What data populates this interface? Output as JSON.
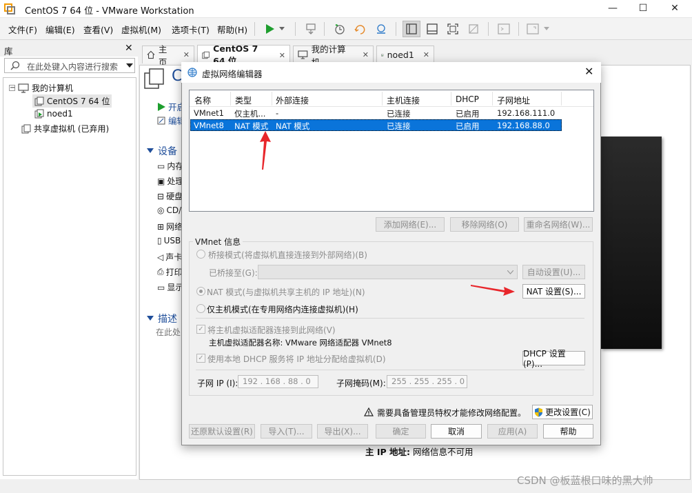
{
  "window": {
    "title": "CentOS 7 64 位 - VMware Workstation",
    "min": "—",
    "max": "☐",
    "close": "✕"
  },
  "menu": {
    "items": [
      "文件(F)",
      "编辑(E)",
      "查看(V)",
      "虚拟机(M)",
      "选项卡(T)",
      "帮助(H)"
    ]
  },
  "library": {
    "title": "库",
    "close": "✕",
    "search_placeholder": "在此处键入内容进行搜索",
    "tree": {
      "root": "我的计算机",
      "children": [
        "CentOS 7 64 位",
        "noed1"
      ],
      "shared": "共享虚拟机 (已弃用)"
    }
  },
  "tabs": [
    {
      "label": "主页",
      "close": "✕"
    },
    {
      "label": "CentOS 7 64 位",
      "close": "✕"
    },
    {
      "label": "我的计算机",
      "close": "✕"
    },
    {
      "label": "noed1",
      "close": "✕"
    }
  ],
  "main": {
    "vm_title_letter": "C",
    "power_on": "开启",
    "edit": "编辑",
    "devices_header": "设备",
    "devices": [
      "内存",
      "处理",
      "硬盘",
      "CD/",
      "网络",
      "USB",
      "声卡",
      "打印",
      "显示"
    ],
    "desc_header": "描述",
    "desc_hint": "在此处",
    "ip_label": "主 IP 地址:",
    "ip_value": "网络信息不可用"
  },
  "dialog": {
    "title": "虚拟网络编辑器",
    "close": "✕",
    "columns": [
      "名称",
      "类型",
      "外部连接",
      "主机连接",
      "DHCP",
      "子网地址"
    ],
    "rows": [
      [
        "VMnet1",
        "仅主机...",
        "-",
        "已连接",
        "已启用",
        "192.168.111.0"
      ],
      [
        "VMnet8",
        "NAT 模式",
        "NAT 模式",
        "已连接",
        "已启用",
        "192.168.88.0"
      ]
    ],
    "selected_row": 1,
    "add_network": "添加网络(E)...",
    "remove_network": "移除网络(O)",
    "rename_network": "重命名网络(W)...",
    "vmnet_info": "VMnet 信息",
    "bridge_mode": "桥接模式(将虚拟机直接连接到外部网络)(B)",
    "bridged_to": "已桥接至(G):",
    "auto_settings": "自动设置(U)...",
    "nat_mode": "NAT 模式(与虚拟机共享主机的 IP 地址)(N)",
    "nat_settings": "NAT 设置(S)...",
    "host_only_mode": "仅主机模式(在专用网络内连接虚拟机)(H)",
    "connect_adapter": "将主机虚拟适配器连接到此网络(V)",
    "adapter_name": "主机虚拟适配器名称: VMware 网络适配器 VMnet8",
    "use_dhcp": "使用本地 DHCP 服务将 IP 地址分配给虚拟机(D)",
    "dhcp_settings": "DHCP 设置(P)...",
    "subnet_ip_label": "子网 IP (I):",
    "subnet_ip": "192 . 168 . 88 . 0",
    "subnet_mask_label": "子网掩码(M):",
    "subnet_mask": "255 . 255 . 255 . 0",
    "admin_notice": "需要具备管理员特权才能修改网络配置。",
    "change_settings": "更改设置(C)",
    "restore_defaults": "还原默认设置(R)",
    "import": "导入(T)...",
    "export": "导出(X)...",
    "ok": "确定",
    "cancel": "取消",
    "apply": "应用(A)",
    "help": "帮助"
  },
  "watermark": "CSDN @板蓝根口味的黑大帅",
  "colors": {
    "selection": "#0a74da",
    "arrow": "#e8262b",
    "link": "#1f4e9a"
  }
}
